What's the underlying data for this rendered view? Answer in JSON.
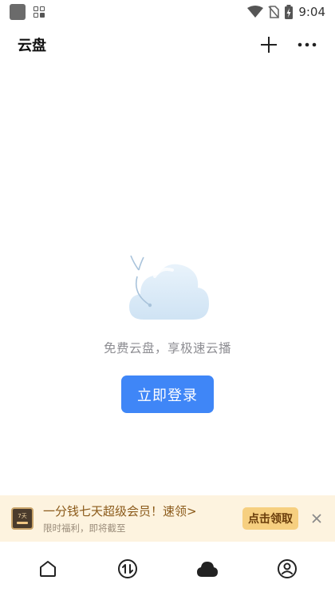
{
  "status_bar": {
    "time": "9:04",
    "icons": [
      "app-square-icon",
      "grid-icon",
      "wifi-icon",
      "no-sim-icon",
      "battery-charging-icon"
    ]
  },
  "header": {
    "title": "云盘",
    "actions": [
      "plus-icon",
      "more-icon"
    ]
  },
  "empty_state": {
    "illustration": "cloud-illustration",
    "message": "免费云盘，享极速云播",
    "login_label": "立即登录"
  },
  "promo": {
    "badge_text": "7天",
    "title": "一分钱七天超级会员！速领>",
    "subtitle": "限时福利，即将截至",
    "claim_label": "点击领取",
    "close_icon": "close-icon"
  },
  "bottom_nav": {
    "items": [
      {
        "icon": "home-icon",
        "active": false
      },
      {
        "icon": "transfer-icon",
        "active": false
      },
      {
        "icon": "cloud-icon",
        "active": true
      },
      {
        "icon": "profile-icon",
        "active": false
      }
    ]
  },
  "colors": {
    "accent": "#3f86f7",
    "promo_bg": "#fdf3df",
    "promo_title": "#8b5a1a",
    "claim_bg": "#f6cf80"
  }
}
